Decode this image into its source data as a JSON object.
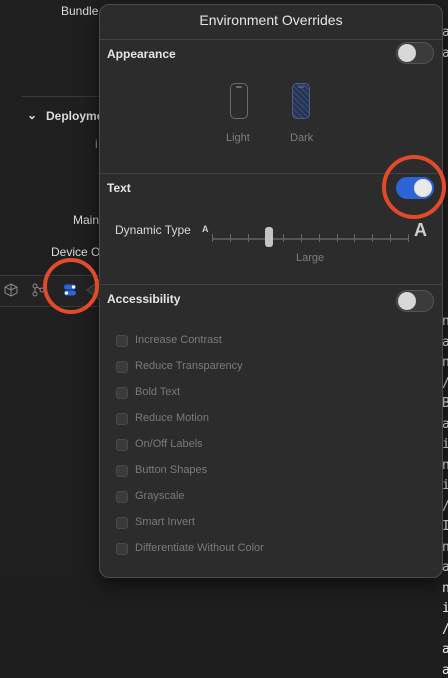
{
  "background": {
    "bundle_label": "Bundle",
    "deployment_label": "Deployme",
    "info_glyph": "i",
    "main_label": "Main",
    "device_label": "Device O",
    "terminal_chars": [
      "a",
      "a",
      "n",
      "a",
      "n",
      "/",
      "B",
      "a",
      "i",
      "n",
      "i",
      "/",
      "I",
      "n",
      "a",
      "n",
      "i",
      "/",
      "a",
      "a"
    ]
  },
  "popover": {
    "title": "Environment Overrides",
    "appearance": {
      "title": "Appearance",
      "toggle_on": false,
      "light_label": "Light",
      "dark_label": "Dark"
    },
    "text": {
      "title": "Text",
      "toggle_on": true,
      "dynamic_type_label": "Dynamic Type",
      "small_glyph": "A",
      "large_glyph": "A",
      "size_value": "Large"
    },
    "accessibility": {
      "title": "Accessibility",
      "toggle_on": false,
      "options": [
        "Increase Contrast",
        "Reduce Transparency",
        "Bold Text",
        "Reduce Motion",
        "On/Off Labels",
        "Button Shapes",
        "Grayscale",
        "Smart Invert",
        "Differentiate Without Color"
      ]
    }
  },
  "colors": {
    "accent": "#2d65d9",
    "annotation": "#e24a2a"
  }
}
